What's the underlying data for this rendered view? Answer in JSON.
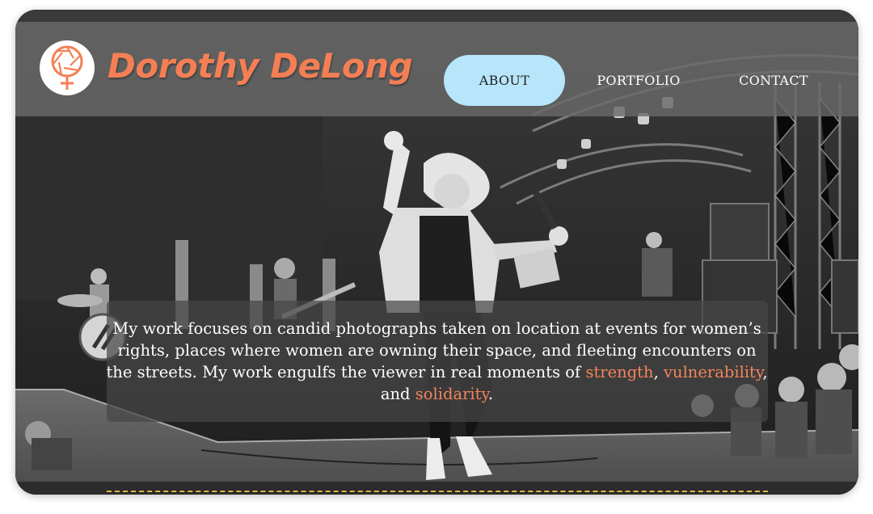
{
  "brand": {
    "name": "Dorothy DeLong",
    "logo_icon": "aperture-venus-icon",
    "accent_color": "#f47f55"
  },
  "nav": {
    "items": [
      {
        "label": "ABOUT",
        "active": true
      },
      {
        "label": "PORTFOLIO",
        "active": false
      },
      {
        "label": "CONTACT",
        "active": false
      }
    ],
    "active_color": "#b7e6fb"
  },
  "intro": {
    "text_before": "My work focuses on candid photographs taken on location at events for women’s rights, places where women are owning their space, and fleeting encounters on the streets. My work engulfs the viewer in real moments of ",
    "highlight_1": "strength",
    "sep_1": ", ",
    "highlight_2": "vulnerability",
    "sep_2": ", and ",
    "highlight_3": "solidarity",
    "text_after": "."
  }
}
